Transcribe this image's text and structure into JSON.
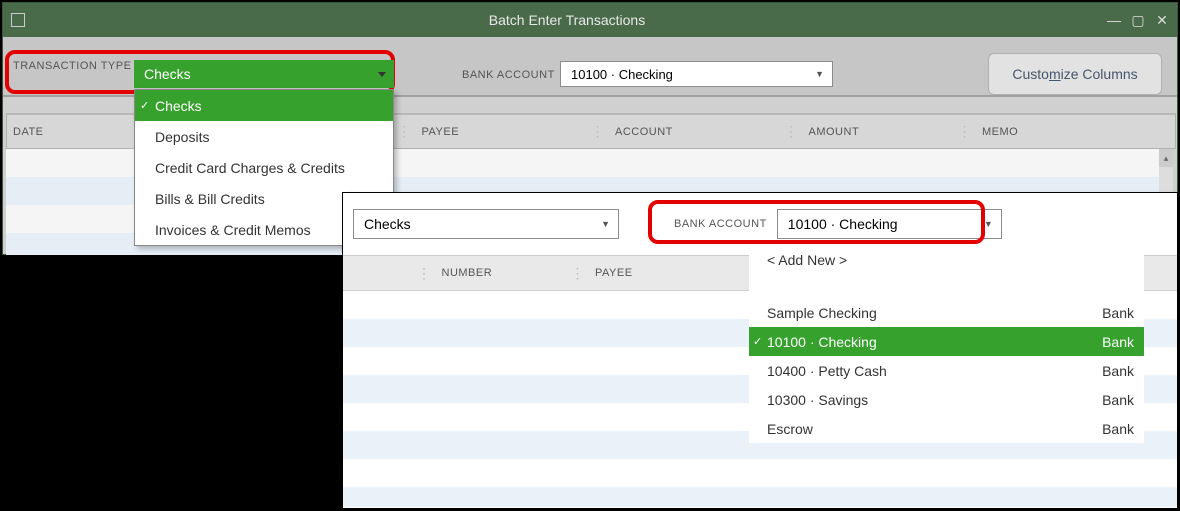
{
  "window": {
    "title": "Batch Enter Transactions"
  },
  "toolbar": {
    "transaction_type_label": "TRANSACTION TYPE",
    "transaction_type_value": "Checks",
    "bank_account_label": "BANK ACCOUNT",
    "bank_account_value": "10100 · Checking",
    "customize_button_prefix": "Custo",
    "customize_button_u": "m",
    "customize_button_suffix": "ize Columns"
  },
  "transaction_type_menu": [
    "Checks",
    "Deposits",
    "Credit Card Charges & Credits",
    "Bills & Bill Credits",
    "Invoices & Credit Memos"
  ],
  "table1_headers": {
    "date": "DATE",
    "payee": "PAYEE",
    "account": "ACCOUNT",
    "amount": "AMOUNT",
    "memo": "MEMO"
  },
  "panel2": {
    "transaction_type_value": "Checks",
    "bank_account_label": "BANK ACCOUNT",
    "bank_account_value": "10100 · Checking",
    "headers": {
      "number": "NUMBER",
      "payee": "PAYEE"
    },
    "add_new": "< Add New >",
    "accounts": [
      {
        "name": "Sample Checking",
        "type": "Bank",
        "selected": false
      },
      {
        "name": "10100 · Checking",
        "type": "Bank",
        "selected": true
      },
      {
        "name": "10400 · Petty Cash",
        "type": "Bank",
        "selected": false
      },
      {
        "name": "10300 · Savings",
        "type": "Bank",
        "selected": false
      },
      {
        "name": "Escrow",
        "type": "Bank",
        "selected": false
      }
    ]
  }
}
